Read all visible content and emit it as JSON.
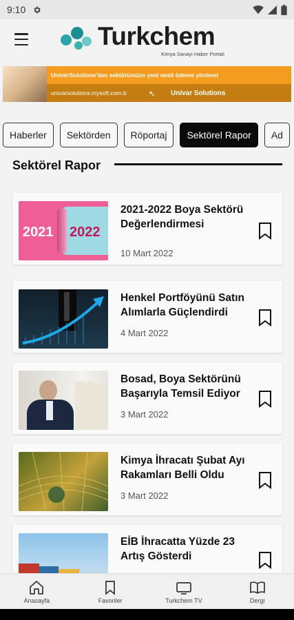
{
  "status": {
    "time": "9:10"
  },
  "header": {
    "logo_text": "Turkchem",
    "logo_sub": "Kimya Sanayi Haber Portalı"
  },
  "banner": {
    "headline": "UniverSolutions'dan sektörümüze yeni nesil ödeme yöntemi",
    "url": "univarsolutions.mysoft.com.tr",
    "brand": "Univar Solutions"
  },
  "tabs": [
    {
      "label": "Haberler"
    },
    {
      "label": "Sektörden"
    },
    {
      "label": "Röportaj"
    },
    {
      "label": "Sektörel Rapor",
      "active": true
    },
    {
      "label": "Ad"
    }
  ],
  "section": {
    "title": "Sektörel Rapor"
  },
  "articles": [
    {
      "title": "2021-2022 Boya Sektörü Değerlendirmesi",
      "date": "10 Mart 2022",
      "thumb_year_a": "2021",
      "thumb_year_b": "2022"
    },
    {
      "title": "Henkel Portföyünü Satın Alımlarla Güçlendirdi",
      "date": "4 Mart 2022"
    },
    {
      "title": "Bosad, Boya Sektörünü Başarıyla Temsil Ediyor",
      "date": "3 Mart 2022"
    },
    {
      "title": "Kimya İhracatı Şubat Ayı Rakamları Belli Oldu",
      "date": "3 Mart 2022"
    },
    {
      "title": "EİB İhracatta Yüzde 23 Artış Gösterdi",
      "date": ""
    }
  ],
  "bottom_nav": [
    {
      "label": "Anasayfa",
      "icon": "home-icon"
    },
    {
      "label": "Favoriler",
      "icon": "bookmark-icon"
    },
    {
      "label": "Turkchem TV",
      "icon": "tv-icon"
    },
    {
      "label": "Dergi",
      "icon": "book-icon"
    }
  ]
}
